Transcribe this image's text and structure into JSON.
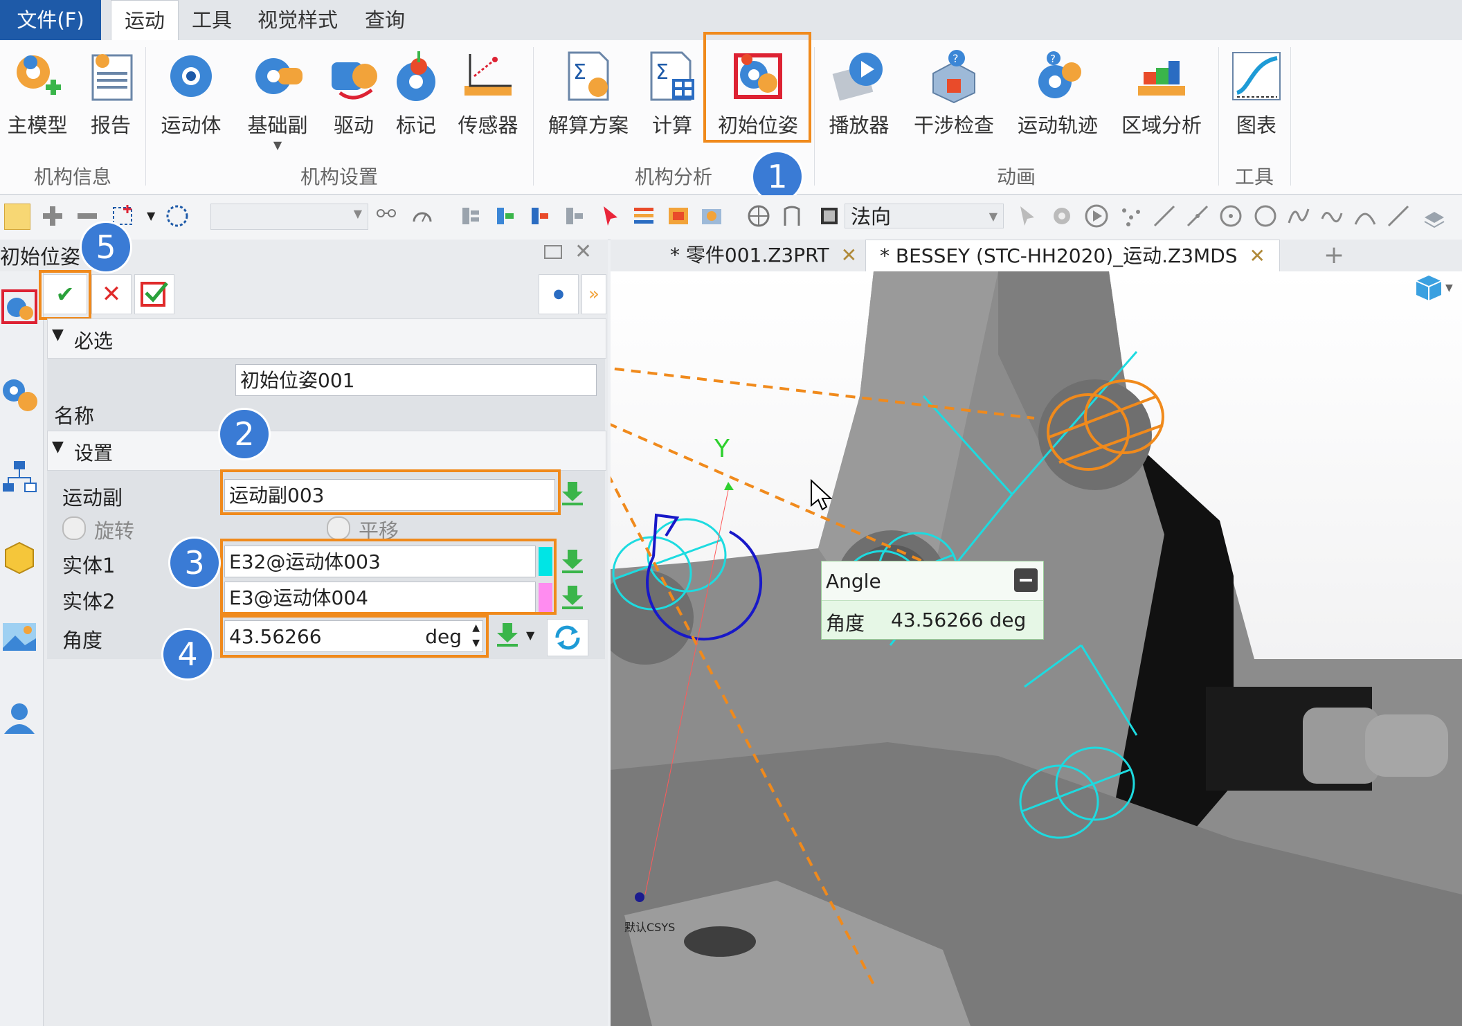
{
  "menu": {
    "file": "文件(F)",
    "tabs": [
      "运动",
      "工具",
      "视觉样式",
      "查询"
    ]
  },
  "ribbon": {
    "buttons": [
      {
        "label": "主模型",
        "icon": "gear-plus-icon"
      },
      {
        "label": "报告",
        "icon": "report-icon"
      },
      {
        "label": "运动体",
        "icon": "motion-body-icon"
      },
      {
        "label": "基础副",
        "icon": "joint-icon"
      },
      {
        "label": "驱动",
        "icon": "driver-icon"
      },
      {
        "label": "标记",
        "icon": "marker-icon"
      },
      {
        "label": "传感器",
        "icon": "sensor-icon"
      },
      {
        "label": "解算方案",
        "icon": "solution-icon"
      },
      {
        "label": "计算",
        "icon": "calculate-icon"
      },
      {
        "label": "初始位姿",
        "icon": "initial-pose-icon"
      },
      {
        "label": "播放器",
        "icon": "player-icon"
      },
      {
        "label": "干涉检查",
        "icon": "interference-icon"
      },
      {
        "label": "运动轨迹",
        "icon": "trajectory-icon"
      },
      {
        "label": "区域分析",
        "icon": "region-analysis-icon"
      },
      {
        "label": "图表",
        "icon": "chart-icon"
      }
    ],
    "groups": [
      "机构信息",
      "机构设置",
      "机构分析",
      "动画",
      "工具"
    ]
  },
  "toolbar": {
    "view_direction": "法向"
  },
  "panel": {
    "title": "初始位姿",
    "sections": {
      "required": "必选",
      "settings": "设置"
    },
    "name_label": "名称",
    "name_value": "初始位姿001",
    "joint_label": "运动副",
    "joint_value": "运动副003",
    "radio_rotate": "旋转",
    "radio_translate": "平移",
    "entity1_label": "实体1",
    "entity1_value": "E32@运动体003",
    "entity2_label": "实体2",
    "entity2_value": "E3@运动体004",
    "angle_label": "角度",
    "angle_value": "43.56266",
    "angle_unit": "deg",
    "colors": {
      "entity1": "#00e5e5",
      "entity2": "#ff8cf0"
    }
  },
  "tabs": {
    "tab1": "* 零件001.Z3PRT",
    "tab2": "* BESSEY (STC-HH2020)_运动.Z3MDS",
    "close": "✕",
    "add": "+"
  },
  "viewport": {
    "tooltip_title": "Angle",
    "tooltip_label": "角度",
    "tooltip_value": "43.56266 deg",
    "axis_y": "Y",
    "csys_label": "默认CSYS"
  },
  "badges": [
    "1",
    "2",
    "3",
    "4",
    "5"
  ],
  "colors": {
    "accent": "#f08a1c",
    "badge": "#3a7bd5",
    "menu_file": "#1e5aa8"
  }
}
